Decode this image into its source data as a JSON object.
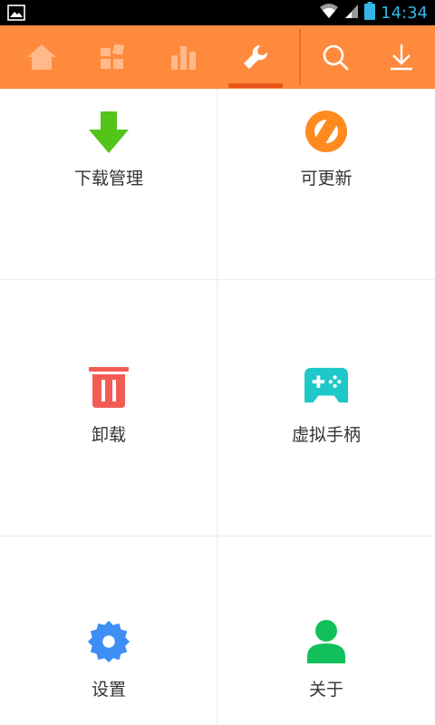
{
  "status_bar": {
    "time": "14:34",
    "icons": [
      "image-icon",
      "wifi-icon",
      "signal-icon",
      "battery-icon"
    ]
  },
  "nav": {
    "items": [
      {
        "name": "home",
        "icon": "home-icon",
        "active": false
      },
      {
        "name": "apps",
        "icon": "apps-icon",
        "active": false
      },
      {
        "name": "ranking",
        "icon": "bar-chart-icon",
        "active": false
      },
      {
        "name": "tools",
        "icon": "wrench-icon",
        "active": true
      }
    ],
    "actions": [
      {
        "name": "search",
        "icon": "search-icon"
      },
      {
        "name": "download",
        "icon": "download-icon"
      }
    ]
  },
  "grid": {
    "items": [
      {
        "label": "下载管理",
        "icon": "download-arrow-icon"
      },
      {
        "label": "可更新",
        "icon": "update-icon"
      },
      {
        "label": "卸载",
        "icon": "trash-icon"
      },
      {
        "label": "虚拟手柄",
        "icon": "gamepad-icon"
      },
      {
        "label": "设置",
        "icon": "settings-gear-icon"
      },
      {
        "label": "关于",
        "icon": "person-icon"
      }
    ]
  },
  "colors": {
    "topbar": "#ff8a3d",
    "download_green": "#52c41a",
    "update_orange": "#ff8a1f",
    "trash_red": "#f25c54",
    "gamepad_teal": "#1fc8c8",
    "gear_blue": "#3d8ef5",
    "person_green": "#11c05a"
  }
}
